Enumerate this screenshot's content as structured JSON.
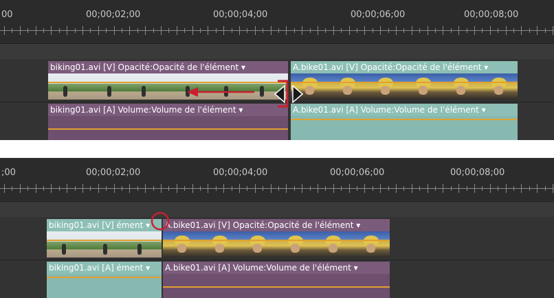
{
  "top": {
    "timecodes": [
      "00",
      "00;00;02;00",
      "00;00;04;00",
      "00;00;06;00",
      "00;00;08;00"
    ],
    "video_clip_1": "biking01.avi [V] Opacité:Opacité de l'élément ▾",
    "audio_clip_1": "biking01.avi [A] Volume:Volume de l'élément ▾",
    "video_clip_2": "A.bike01.avi [V] Opacité:Opacité de l'élément ▾",
    "audio_clip_2": "A.bike01.avi [A] Volume:Volume de l'élément ▾"
  },
  "bottom": {
    "timecodes": [
      ";00",
      "00;00;02;00",
      "00;00;04;00",
      "00;00;06;00",
      "00;00;08;00"
    ],
    "video_clip_1": "biking01.avi [V] ément ▾",
    "audio_clip_1": "biking01.avi [A] ément ▾",
    "video_clip_2": "A.bike01.avi [V] Opacité:Opacité de l'élément ▾",
    "audio_clip_2": "A.bike01.avi [A] Volume:Volume de l'élément ▾"
  },
  "icons": {
    "rolling_edit": "rolling-edit-icon",
    "arrow": "arrow-left-icon",
    "highlight": "circle-highlight-icon"
  },
  "colors": {
    "annotation_red": "#c8202f",
    "orange_line": "#e3a02e",
    "video_purple": "#6e4f6e",
    "audio_teal": "#88b9b0"
  }
}
